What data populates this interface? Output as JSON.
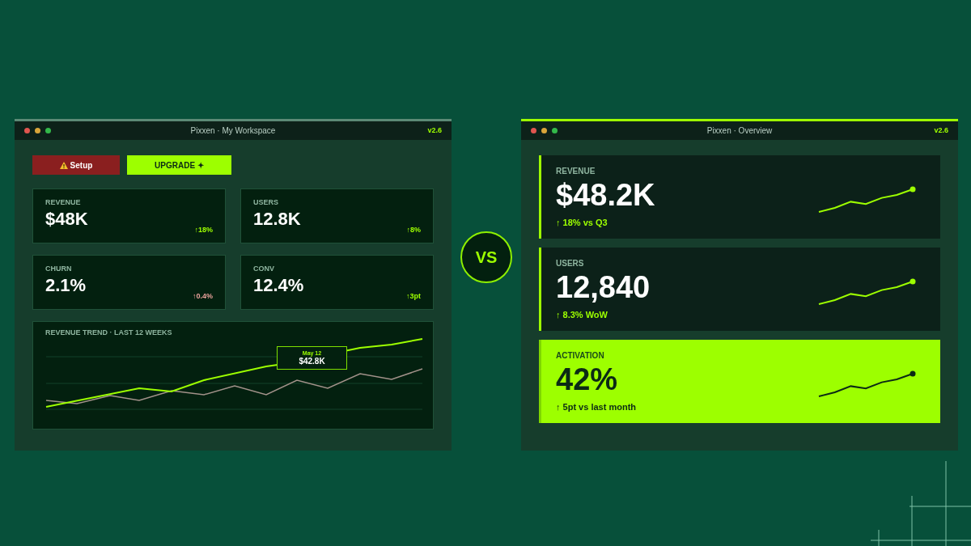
{
  "left_window": {
    "title": "Pixxen · My Workspace",
    "version": "v2.6",
    "color": "#5c8a76",
    "buttons": [
      {
        "kind": "warning",
        "label": "Setup"
      },
      {
        "kind": "primary",
        "label": "UPGRADE ✦"
      }
    ],
    "metrics": [
      {
        "label": "REVENUE",
        "value": "$48K",
        "delta": "↑18%",
        "color": "#9dff00"
      },
      {
        "label": "USERS",
        "value": "12.8K",
        "delta": "↑8%",
        "color": "#9dff00"
      },
      {
        "label": "CHURN",
        "value": "2.1%",
        "delta": "↑0.4%",
        "color": "#e8a19a"
      },
      {
        "label": "CONV",
        "value": "12.4%",
        "delta": "↑3pt",
        "color": "#9dff00"
      }
    ],
    "trend": {
      "title": "REVENUE TREND · LAST 12 WEEKS",
      "tooltip": {
        "date": "May 12",
        "value": "$42.8K"
      }
    }
  },
  "vs": "VS",
  "right_window": {
    "title": "Pixxen · Overview",
    "version": "v2.6",
    "color": "#9dff00",
    "cards": [
      {
        "label": "REVENUE",
        "value": "$48.2K",
        "delta": "↑ 18% vs Q3",
        "highlighted": false
      },
      {
        "label": "USERS",
        "value": "12,840",
        "delta": "↑ 8.3% WoW",
        "highlighted": false
      },
      {
        "label": "ACTIVATION",
        "value": "42%",
        "delta": "↑ 5pt vs last month",
        "highlighted": true
      }
    ]
  }
}
